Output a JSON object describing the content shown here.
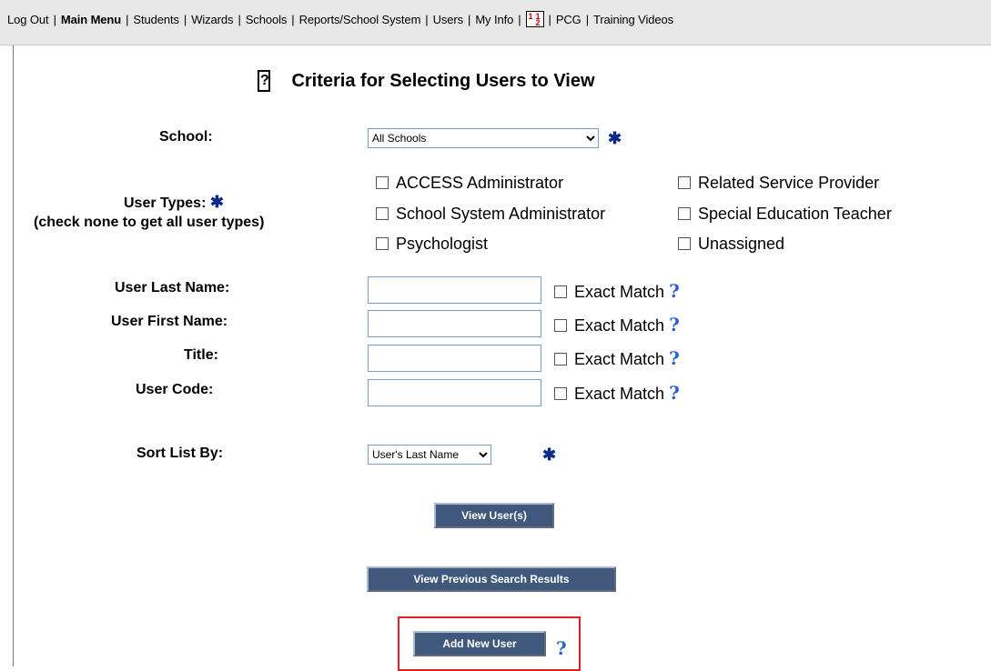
{
  "nav": {
    "items": [
      "Log Out",
      "Main Menu",
      "Students",
      "Wizards",
      "Schools",
      "Reports/School System",
      "Users",
      "My Info",
      "PCG",
      "Training Videos"
    ],
    "separator": "|",
    "calc_icon_text": [
      "1",
      "1",
      "2"
    ]
  },
  "page": {
    "title": "Criteria for Selecting Users to View"
  },
  "form": {
    "school_label": "School:",
    "school_value": "All Schools",
    "user_types_label": "User Types:",
    "user_types_hint": "(check none to get all user types)",
    "user_types": [
      "ACCESS Administrator",
      "School System Administrator",
      "Psychologist",
      "Related Service Provider",
      "Special Education Teacher",
      "Unassigned"
    ],
    "fields": [
      {
        "label": "User Last Name:",
        "value": "",
        "exact": "Exact Match"
      },
      {
        "label": "User First Name:",
        "value": "",
        "exact": "Exact Match"
      },
      {
        "label": "Title:",
        "value": "",
        "exact": "Exact Match"
      },
      {
        "label": "User Code:",
        "value": "",
        "exact": "Exact Match"
      }
    ],
    "sort_label": "Sort List By:",
    "sort_value": "User's Last Name",
    "required_marker": "✱",
    "help_marker": "?"
  },
  "buttons": {
    "view_users": "View User(s)",
    "view_previous": "View Previous Search Results",
    "add_new_user": "Add New User"
  },
  "colors": {
    "button_bg": "#40587c",
    "required_star": "#0a2a8a",
    "help": "#2b5fcc",
    "highlight": "#e02020"
  }
}
